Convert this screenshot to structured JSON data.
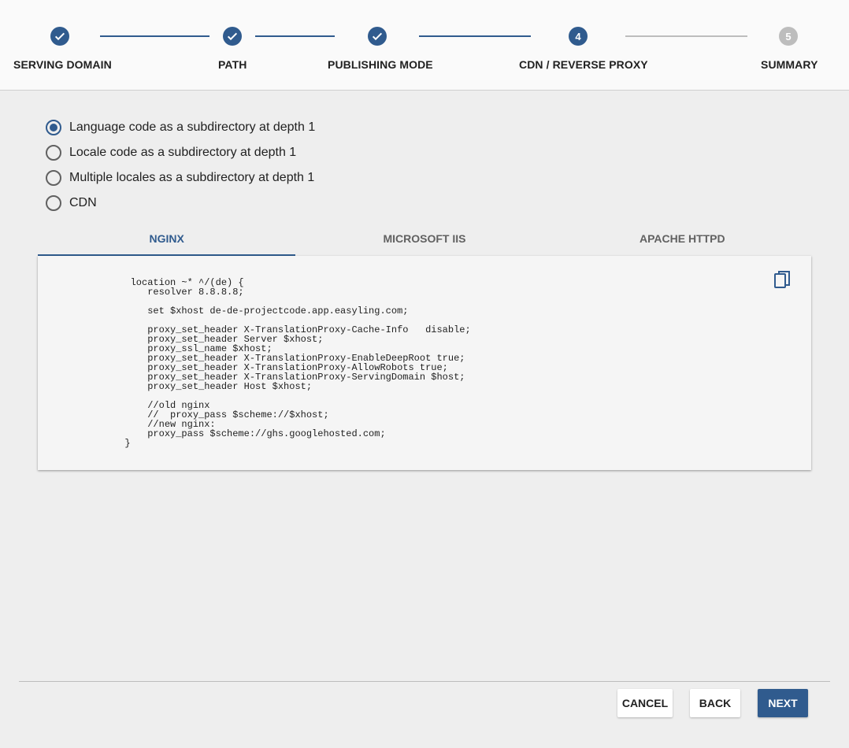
{
  "colors": {
    "accent": "#305b8e",
    "pending": "#bdbdbd"
  },
  "stepper": {
    "steps": [
      {
        "label": "SERVING DOMAIN",
        "state": "done",
        "icon": "check-icon"
      },
      {
        "label": "PATH",
        "state": "done",
        "icon": "check-icon"
      },
      {
        "label": "PUBLISHING MODE",
        "state": "done",
        "icon": "check-icon"
      },
      {
        "label": "CDN / REVERSE PROXY",
        "state": "active",
        "number": "4"
      },
      {
        "label": "SUMMARY",
        "state": "pending",
        "number": "5"
      }
    ]
  },
  "options": {
    "selected_index": 0,
    "items": [
      "Language code as a subdirectory at depth 1",
      "Locale code as a subdirectory at depth 1",
      "Multiple locales as a subdirectory at depth 1",
      "CDN"
    ]
  },
  "tabs": {
    "active_index": 0,
    "items": [
      "NGINX",
      "MICROSOFT IIS",
      "APACHE HTTPD"
    ]
  },
  "code": {
    "copy_icon": "copy-icon",
    "text": "        location ~* ^/(de) {\n           resolver 8.8.8.8;\n\n           set $xhost de-de-projectcode.app.easyling.com;\n\n           proxy_set_header X-TranslationProxy-Cache-Info   disable;\n           proxy_set_header Server $xhost;\n           proxy_ssl_name $xhost;\n           proxy_set_header X-TranslationProxy-EnableDeepRoot true;\n           proxy_set_header X-TranslationProxy-AllowRobots true;\n           proxy_set_header X-TranslationProxy-ServingDomain $host;\n           proxy_set_header Host $xhost;\n\n           //old nginx\n           //  proxy_pass $scheme://$xhost;\n           //new nginx:\n           proxy_pass $scheme://ghs.googlehosted.com;\n       }"
  },
  "footer": {
    "cancel_label": "CANCEL",
    "back_label": "BACK",
    "next_label": "NEXT"
  }
}
